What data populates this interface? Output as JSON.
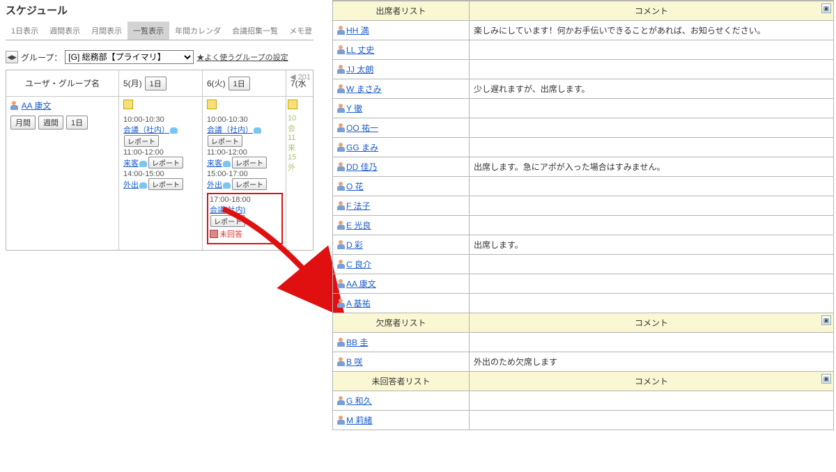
{
  "header": {
    "title": "スケジュール"
  },
  "tabs": {
    "items": [
      "1日表示",
      "週間表示",
      "月間表示",
      "一覧表示",
      "年間カレンダ",
      "会議招集一覧",
      "メモ登"
    ],
    "activeIndex": 3
  },
  "toolbar": {
    "group_label": "グループ：",
    "group_selected": "[G] 総務部【プライマリ】",
    "fav_link": "★よく使うグループの設定"
  },
  "calendar": {
    "date_nav_partial": "201",
    "head_col1": "ユーザ・グループ名",
    "cols": [
      {
        "label": "5(月)",
        "btn": "1日"
      },
      {
        "label": "6(火)",
        "btn": "1日"
      },
      {
        "label": "7(水",
        "btn": ""
      }
    ],
    "user": {
      "name": "AA 康文",
      "btns": [
        "月間",
        "週間",
        "1日"
      ]
    },
    "day5": {
      "events": [
        {
          "time": "10:00-10:30",
          "title": "会議（社内）",
          "report": "レポート"
        },
        {
          "time": "11:00-12:00",
          "title": "来客",
          "report": "レポート"
        },
        {
          "time": "14:00-15:00",
          "title": "外出",
          "report": "レポート"
        }
      ]
    },
    "day6": {
      "events": [
        {
          "time": "10:00-10:30",
          "title": "会議（社内）",
          "report": "レポート"
        },
        {
          "time": "11:00-12:00",
          "title": "来客",
          "report": "レポート"
        },
        {
          "time": "15:00-17:00",
          "title": "外出",
          "report": "レポート"
        }
      ],
      "highlight": {
        "time": "17:00-18:00",
        "title": "会議(社内)",
        "report": "レポート",
        "status": "未回答"
      }
    },
    "day7_stub": [
      "10",
      "会",
      "11",
      "来",
      "15",
      "外"
    ]
  },
  "panels": {
    "attend": {
      "th_name": "出席者リスト",
      "th_cmt": "コメント",
      "rows": [
        {
          "name": "HH 満",
          "cmt": "楽しみにしています！何かお手伝いできることがあれば、お知らせください。"
        },
        {
          "name": "LL 丈史",
          "cmt": ""
        },
        {
          "name": "JJ 太朗",
          "cmt": ""
        },
        {
          "name": "W まさみ",
          "cmt": "少し遅れますが、出席します。"
        },
        {
          "name": "Y 徹",
          "cmt": ""
        },
        {
          "name": "OO 祐一",
          "cmt": ""
        },
        {
          "name": "GG まみ",
          "cmt": ""
        },
        {
          "name": "DD 佳乃",
          "cmt": "出席します。急にアポが入った場合はすみません。"
        },
        {
          "name": "O 花",
          "cmt": ""
        },
        {
          "name": "F 法子",
          "cmt": ""
        },
        {
          "name": "E 光良",
          "cmt": ""
        },
        {
          "name": "D 彩",
          "cmt": "出席します。"
        },
        {
          "name": "C 良介",
          "cmt": ""
        },
        {
          "name": "AA 康文",
          "cmt": ""
        },
        {
          "name": "A 基祐",
          "cmt": ""
        }
      ]
    },
    "absent": {
      "th_name": "欠席者リスト",
      "th_cmt": "コメント",
      "rows": [
        {
          "name": "BB 圭",
          "cmt": ""
        },
        {
          "name": "B 咲",
          "cmt": "外出のため欠席します"
        }
      ]
    },
    "unreply": {
      "th_name": "未回答者リスト",
      "th_cmt": "コメント",
      "rows": [
        {
          "name": "G 和久",
          "cmt": ""
        },
        {
          "name": "M 莉緒",
          "cmt": ""
        }
      ]
    }
  }
}
